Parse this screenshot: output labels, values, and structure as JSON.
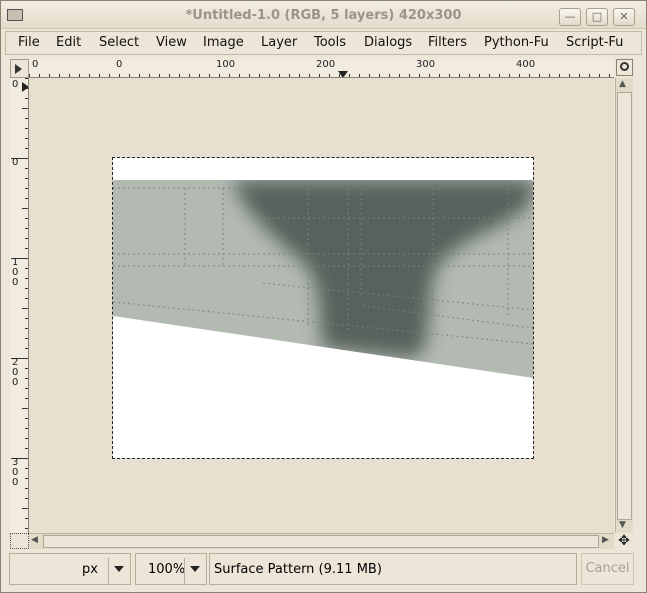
{
  "window": {
    "title": "*Untitled-1.0 (RGB, 5 layers) 420x300"
  },
  "menu": {
    "items": [
      "File",
      "Edit",
      "Select",
      "View",
      "Image",
      "Layer",
      "Tools",
      "Dialogs",
      "Filters",
      "Python-Fu",
      "Script-Fu"
    ]
  },
  "rulers": {
    "horizontal_labels": [
      "0",
      "0",
      "100",
      "200",
      "300",
      "400"
    ],
    "vertical_labels": [
      "0",
      "0",
      "100",
      "200",
      "300"
    ]
  },
  "icons": {
    "ruler_menu": "triangle-right-icon",
    "zoom_fit": "magnifier-icon",
    "navigate": "four-arrows-icon",
    "quick_mask": "dotted-square-icon"
  },
  "canvas": {
    "image_width": 420,
    "image_height": 300,
    "colors": {
      "background": "#ffffff",
      "surface_light": "#b2bab2",
      "surface_dark": "#55605a",
      "selection": "#222222"
    }
  },
  "statusbar": {
    "unit": "px",
    "zoom": "100%",
    "message": "Surface Pattern (9.11 MB)",
    "cancel_label": "Cancel"
  }
}
